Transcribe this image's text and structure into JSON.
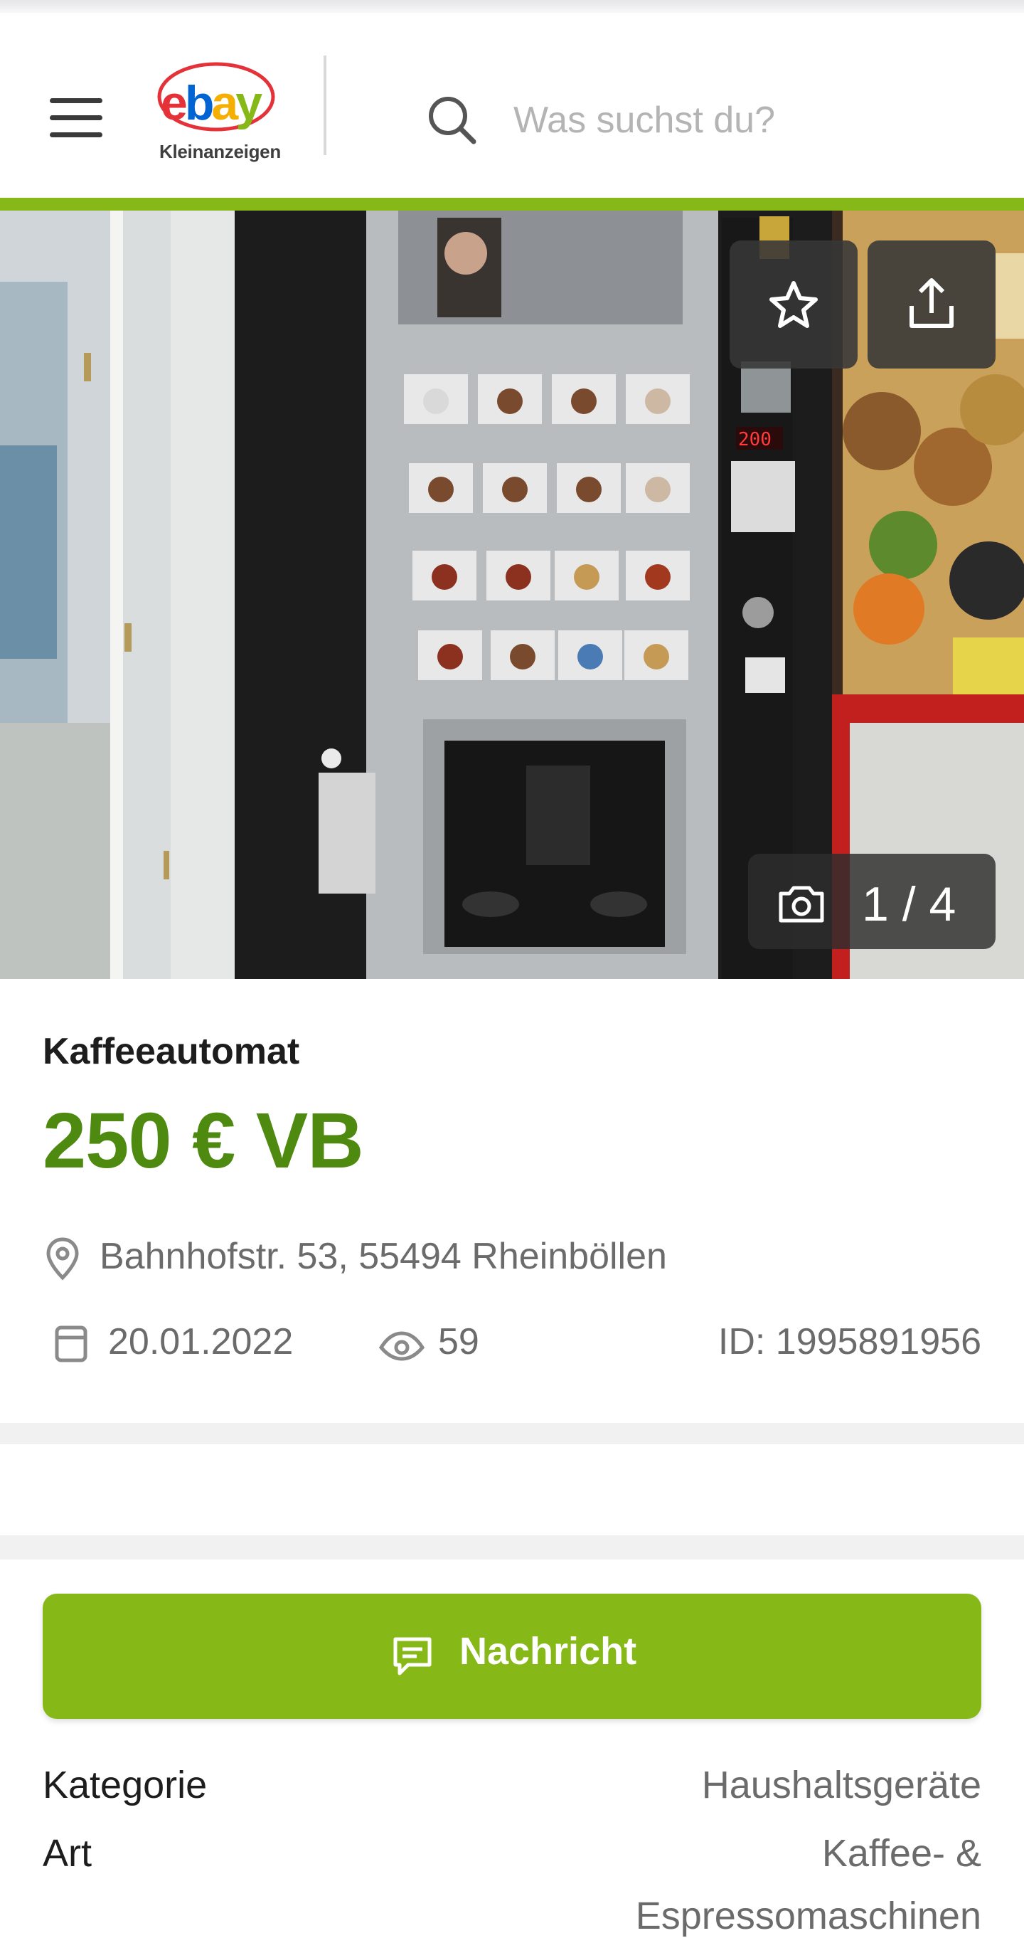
{
  "header": {
    "menu_icon": "hamburger-menu-icon",
    "logo": {
      "word_parts": [
        "e",
        "b",
        "a",
        "y"
      ],
      "word_colors": [
        "#e53238",
        "#0064d2",
        "#f5af02",
        "#86b817"
      ],
      "subtitle": "Kleinanzeigen"
    },
    "search": {
      "placeholder": "Was suchst du?",
      "value": "",
      "icon": "search-icon"
    }
  },
  "gallery": {
    "favorite_icon": "star-icon",
    "share_icon": "share-icon",
    "camera_icon": "camera-icon",
    "counter": "1 / 4",
    "machine_price_display": "200"
  },
  "listing": {
    "title": "Kaffeeautomat",
    "price": "250 € VB",
    "address": "Bahnhofstr. 53, 55494 Rheinböllen",
    "date": "20.01.2022",
    "views": "59",
    "id": "ID: 1995891956",
    "icons": {
      "location": "location-pin-icon",
      "date": "calendar-icon",
      "views": "eye-icon"
    }
  },
  "actions": {
    "message_label": "Nachricht",
    "message_icon": "message-icon"
  },
  "details": [
    {
      "label": "Kategorie",
      "value": "Haushaltsgeräte"
    },
    {
      "label": "Art",
      "value": "Kaffee- &",
      "value_cont": "Espressomaschinen"
    }
  ],
  "colors": {
    "accent": "#86b817",
    "price": "#4e8a0f",
    "muted": "#6b6b6b"
  }
}
